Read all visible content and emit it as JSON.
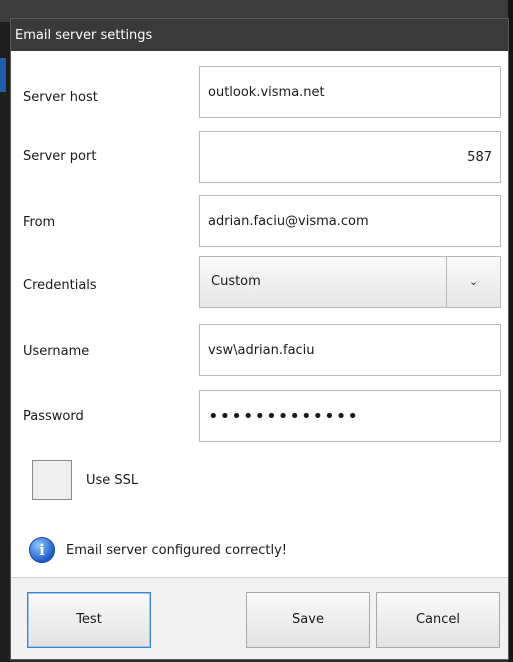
{
  "dialog": {
    "title": "Email server settings"
  },
  "fields": {
    "server_host": {
      "label": "Server host",
      "value": "outlook.visma.net"
    },
    "server_port": {
      "label": "Server port",
      "value": "587"
    },
    "from": {
      "label": "From",
      "value": "adrian.faciu@visma.com"
    },
    "credentials": {
      "label": "Credentials",
      "value": "Custom"
    },
    "username": {
      "label": "Username",
      "value": "vsw\\adrian.faciu"
    },
    "password": {
      "label": "Password",
      "value": "•••••••••••••"
    }
  },
  "ssl": {
    "label": "Use SSL",
    "checked": false
  },
  "status": {
    "icon": "info-icon",
    "icon_glyph": "i",
    "text": "Email server configured correctly!"
  },
  "buttons": {
    "test": "Test",
    "save": "Save",
    "cancel": "Cancel"
  },
  "colors": {
    "titlebar": "#3a3a3a",
    "default_button_border": "#3b82d6",
    "info_icon": "#1d5fc9"
  }
}
